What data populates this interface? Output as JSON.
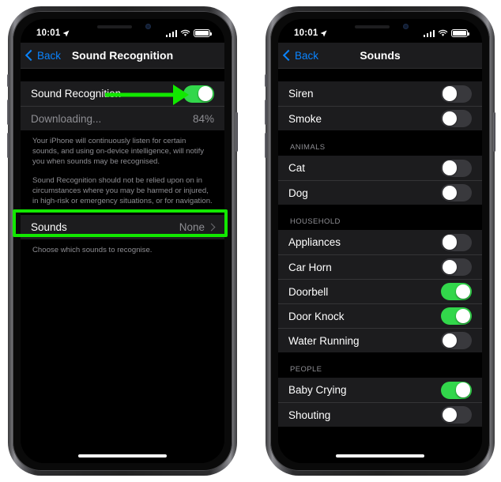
{
  "phones": [
    {
      "id": "sound-recognition",
      "status": {
        "time": "10:01",
        "location_icon": "location-arrow-icon",
        "signal_icon": "cellular-bars-icon",
        "wifi_icon": "wifi-icon",
        "battery_icon": "battery-full-icon"
      },
      "nav": {
        "back_label": "Back",
        "title": "Sound Recognition"
      },
      "rows": {
        "sound_recognition_label": "Sound Recognition",
        "sound_recognition_on": true,
        "downloading_label": "Downloading...",
        "downloading_value": "84%",
        "sounds_label": "Sounds",
        "sounds_value": "None"
      },
      "footnotes": [
        "Your iPhone will continuously listen for certain sounds, and using on-device intelligence, will notify you when sounds may be recognised.",
        "Sound Recognition should not be relied upon on in circumstances where you may be harmed or injured, in high-risk or emergency situations, or for navigation."
      ],
      "sounds_footnote": "Choose which sounds to recognise."
    },
    {
      "id": "sounds",
      "status": {
        "time": "10:01",
        "location_icon": "location-arrow-icon",
        "signal_icon": "cellular-bars-icon",
        "wifi_icon": "wifi-icon",
        "battery_icon": "battery-full-icon"
      },
      "nav": {
        "back_label": "Back",
        "title": "Sounds"
      },
      "sections": [
        {
          "header": "",
          "items": [
            {
              "label": "Siren",
              "on": false
            },
            {
              "label": "Smoke",
              "on": false
            }
          ]
        },
        {
          "header": "ANIMALS",
          "items": [
            {
              "label": "Cat",
              "on": false
            },
            {
              "label": "Dog",
              "on": false
            }
          ]
        },
        {
          "header": "HOUSEHOLD",
          "items": [
            {
              "label": "Appliances",
              "on": false
            },
            {
              "label": "Car Horn",
              "on": false
            },
            {
              "label": "Doorbell",
              "on": true
            },
            {
              "label": "Door Knock",
              "on": true
            },
            {
              "label": "Water Running",
              "on": false
            }
          ]
        },
        {
          "header": "PEOPLE",
          "items": [
            {
              "label": "Baby Crying",
              "on": true
            },
            {
              "label": "Shouting",
              "on": false
            }
          ]
        }
      ]
    }
  ],
  "annotations": {
    "arrow_color": "#12e800",
    "highlight_color": "#12e800"
  }
}
